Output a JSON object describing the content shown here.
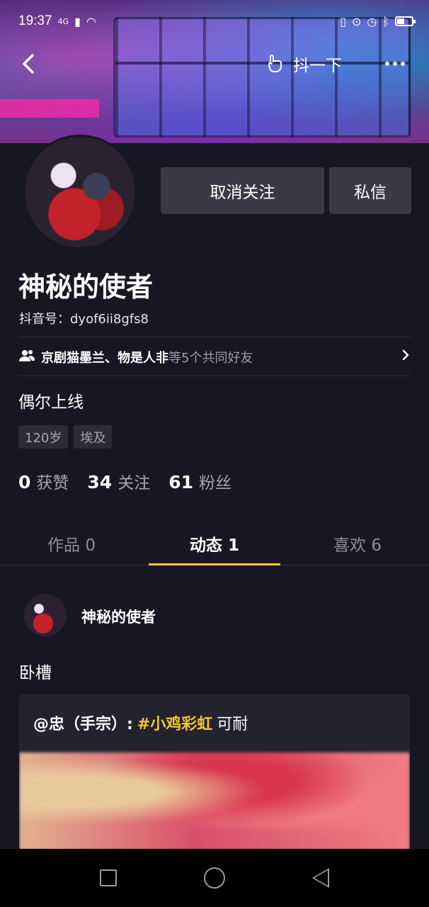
{
  "status_bar": {
    "time": "19:37",
    "network": "4G",
    "signal_icon": "signal-icon",
    "wifi_icon": "wifi-icon"
  },
  "top_nav": {
    "back_icon": "chevron-left-icon",
    "shake_label": "抖一下",
    "more_icon": "more-icon"
  },
  "profile": {
    "nickname": "神秘的使者",
    "douyin_id": "抖音号：dyof6ii8gfs8",
    "unfollow_label": "取消关注",
    "message_label": "私信",
    "mutual_friends": {
      "names": "京剧猫墨兰、物是人非",
      "rest": "等5个共同好友"
    },
    "bio": "偶尔上线",
    "tags": [
      "120岁",
      "埃及"
    ],
    "stats": [
      {
        "num": "0",
        "label": "获赞"
      },
      {
        "num": "34",
        "label": "关注"
      },
      {
        "num": "61",
        "label": "粉丝"
      }
    ]
  },
  "tabs": [
    {
      "label": "作品 0",
      "active": false
    },
    {
      "label": "动态 1",
      "active": true
    },
    {
      "label": "喜欢 6",
      "active": false
    }
  ],
  "post": {
    "author": "神秘的使者",
    "text": "卧槽",
    "repost": {
      "user": "@忠（手宗）:",
      "hashtag": "#小鸡彩虹",
      "extra": "可耐"
    }
  },
  "colors": {
    "background": "#161722",
    "accent": "#f4c535",
    "button": "#393a45"
  }
}
